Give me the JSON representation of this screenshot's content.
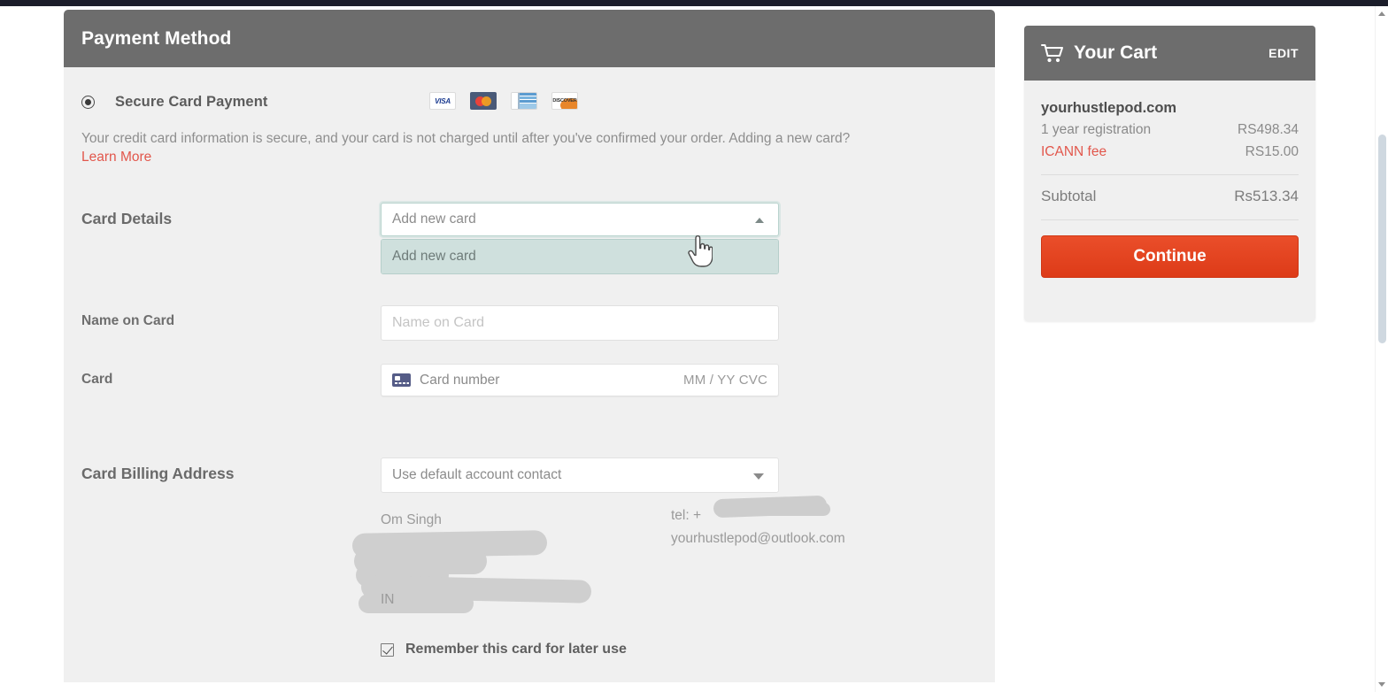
{
  "window": {
    "topbar_color": "#1b1d2a"
  },
  "payment": {
    "header_title": "Payment Method",
    "method": {
      "label": "Secure Card Payment",
      "selected": true
    },
    "card_brands": [
      {
        "name": "visa-card-icon",
        "text": "VISA"
      },
      {
        "name": "mastercard-card-icon",
        "text": ""
      },
      {
        "name": "amex-card-icon",
        "text": ""
      },
      {
        "name": "discover-card-icon",
        "text": "DISCOVER"
      }
    ],
    "secure_note": "Your credit card information is secure, and your card is not charged until after you've confirmed your order. Adding a new card?",
    "learn_more": "Learn More",
    "card_details": {
      "label": "Card Details",
      "select_value": "Add new card",
      "options": [
        "Add new card"
      ],
      "expanded": true
    },
    "name_on_card": {
      "label": "Name on Card",
      "placeholder": "Name on Card",
      "value": ""
    },
    "card": {
      "label": "Card",
      "number_placeholder": "Card number",
      "expiry_cvc_placeholder": "MM / YY  CVC"
    },
    "billing": {
      "label": "Card Billing Address",
      "select_value": "Use default account contact",
      "contact_name": "Om Singh",
      "contact_country": "IN",
      "tel_label": "tel: +",
      "email": "yourhustlepod@outlook.com"
    },
    "remember": {
      "label": "Remember this card for later use",
      "checked": true
    }
  },
  "cart": {
    "title": "Your Cart",
    "edit_label": "EDIT",
    "items": [
      {
        "domain": "yourhustlepod.com",
        "description": "1 year registration",
        "price": "RS498.34"
      }
    ],
    "fee": {
      "label": "ICANN fee",
      "value": "RS15.00"
    },
    "subtotal": {
      "label": "Subtotal",
      "value": "Rs513.34"
    },
    "continue_label": "Continue",
    "accent_color": "#e2574c",
    "button_color": "#e04524"
  }
}
